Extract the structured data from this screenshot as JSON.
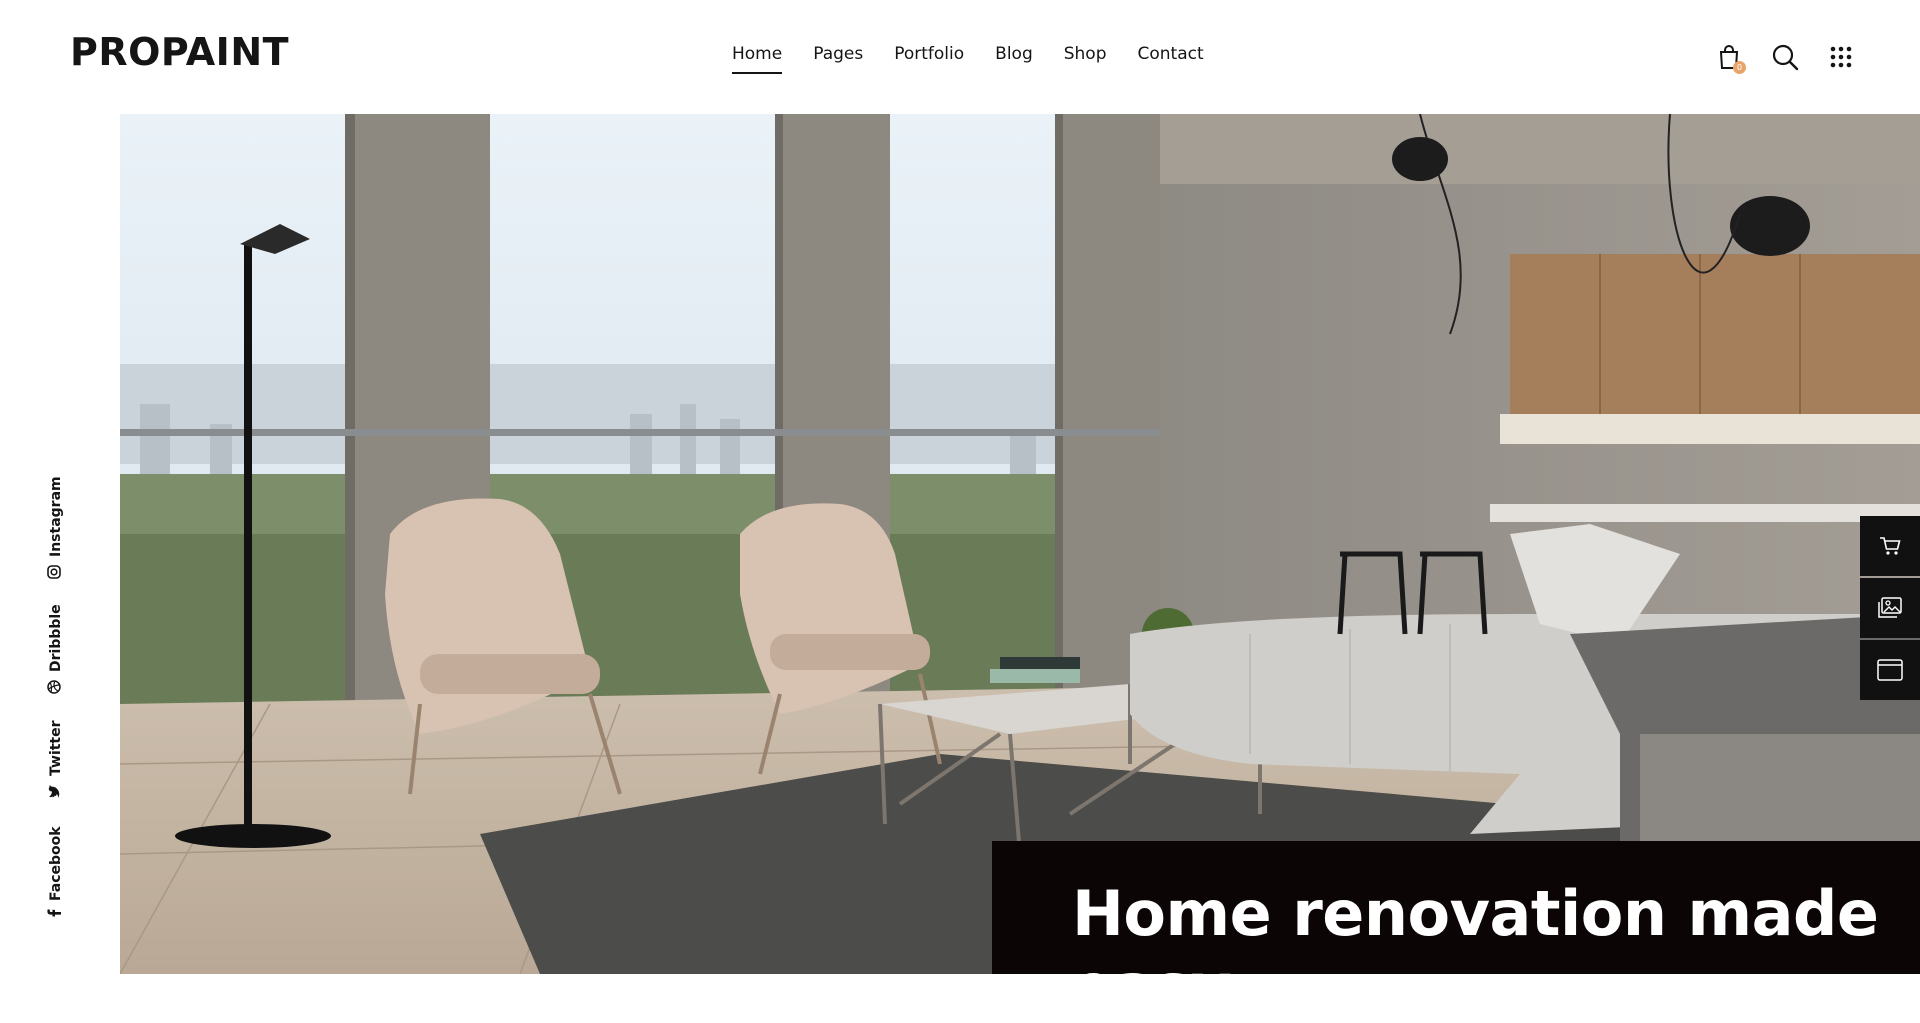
{
  "brand": {
    "logo": "PROPAINT"
  },
  "nav": {
    "items": [
      {
        "label": "Home",
        "active": true
      },
      {
        "label": "Pages"
      },
      {
        "label": "Portfolio"
      },
      {
        "label": "Blog"
      },
      {
        "label": "Shop"
      },
      {
        "label": "Contact"
      }
    ]
  },
  "header": {
    "cart_count": "0",
    "icons": [
      "shopping-bag-icon",
      "search-icon",
      "grid-menu-icon"
    ],
    "accent_color": "#e7a56d"
  },
  "social": {
    "items": [
      {
        "label": "Instagram",
        "icon": "instagram-icon"
      },
      {
        "label": "Dribbble",
        "icon": "dribbble-icon"
      },
      {
        "label": "Twitter",
        "icon": "twitter-icon"
      },
      {
        "label": "Facebook",
        "icon": "facebook-icon"
      }
    ]
  },
  "side_tools": [
    "cart-icon",
    "image-gallery-icon",
    "window-icon"
  ],
  "hero": {
    "caption": "Home renovation made easy"
  }
}
